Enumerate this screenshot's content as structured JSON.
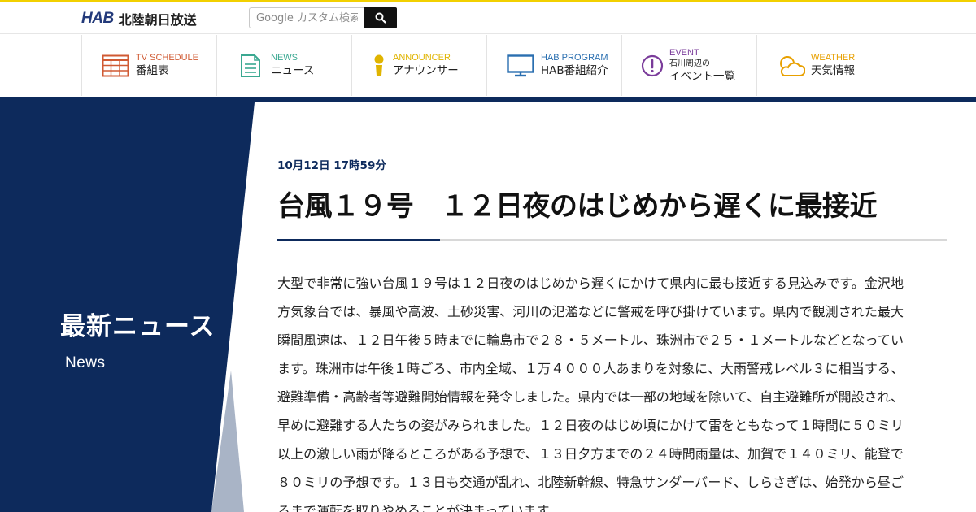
{
  "header": {
    "logo_mark": "HAB",
    "logo_name": "北陸朝日放送",
    "search": {
      "placeholder": "Google カスタム検索",
      "value": ""
    },
    "search_button_icon": "search-icon"
  },
  "nav": {
    "items": [
      {
        "en": "TV SCHEDULE",
        "ja": "番組表",
        "sub": "",
        "icon": "calendar-grid-icon",
        "color": "#d05a33"
      },
      {
        "en": "NEWS",
        "ja": "ニュース",
        "sub": "",
        "icon": "document-icon",
        "color": "#3aa891"
      },
      {
        "en": "ANNOUNCER",
        "ja": "アナウンサー",
        "sub": "",
        "icon": "person-icon",
        "color": "#e0b400"
      },
      {
        "en": "HAB PROGRAM",
        "ja": "HAB番組紹介",
        "sub": "",
        "icon": "monitor-icon",
        "color": "#2a6fb0"
      },
      {
        "en": "EVENT",
        "ja": "イベント一覧",
        "sub": "石川周辺の",
        "icon": "exclamation-circle-icon",
        "color": "#7a3b9a"
      },
      {
        "en": "WEATHER",
        "ja": "天気情報",
        "sub": "",
        "icon": "sun-cloud-icon",
        "color": "#e8a000"
      }
    ]
  },
  "sidebar": {
    "title": "最新ニュース",
    "subtitle": "News"
  },
  "article": {
    "date": "10月12日 17時59分",
    "headline": "台風１９号　１２日夜のはじめから遅くに最接近",
    "body": "大型で非常に強い台風１９号は１２日夜のはじめから遅くにかけて県内に最も接近する見込みです。金沢地方気象台では、暴風や高波、土砂災害、河川の氾濫などに警戒を呼び掛けています。県内で観測された最大瞬間風速は、１２日午後５時までに輪島市で２８・５メートル、珠洲市で２５・１メートルなどとなっています。珠洲市は午後１時ごろ、市内全域、１万４０００人あまりを対象に、大雨警戒レベル３に相当する、避難準備・高齢者等避難開始情報を発令しました。県内では一部の地域を除いて、自主避難所が開設され、早めに避難する人たちの姿がみられました。１２日夜のはじめ頃にかけて雷をともなって１時間に５０ミリ以上の激しい雨が降るところがある予想で、１３日夕方までの２４時間雨量は、加賀で１４０ミリ、能登で８０ミリの予想です。１３日も交通が乱れ、北陸新幹線、特急サンダーバード、しらさぎは、始発から昼ごろまで運転を取りやめることが決まっています。"
  },
  "colors": {
    "accent_yellow": "#f2d000",
    "navy": "#0d2a5c",
    "sidebar_light": "#a9b4c6"
  }
}
